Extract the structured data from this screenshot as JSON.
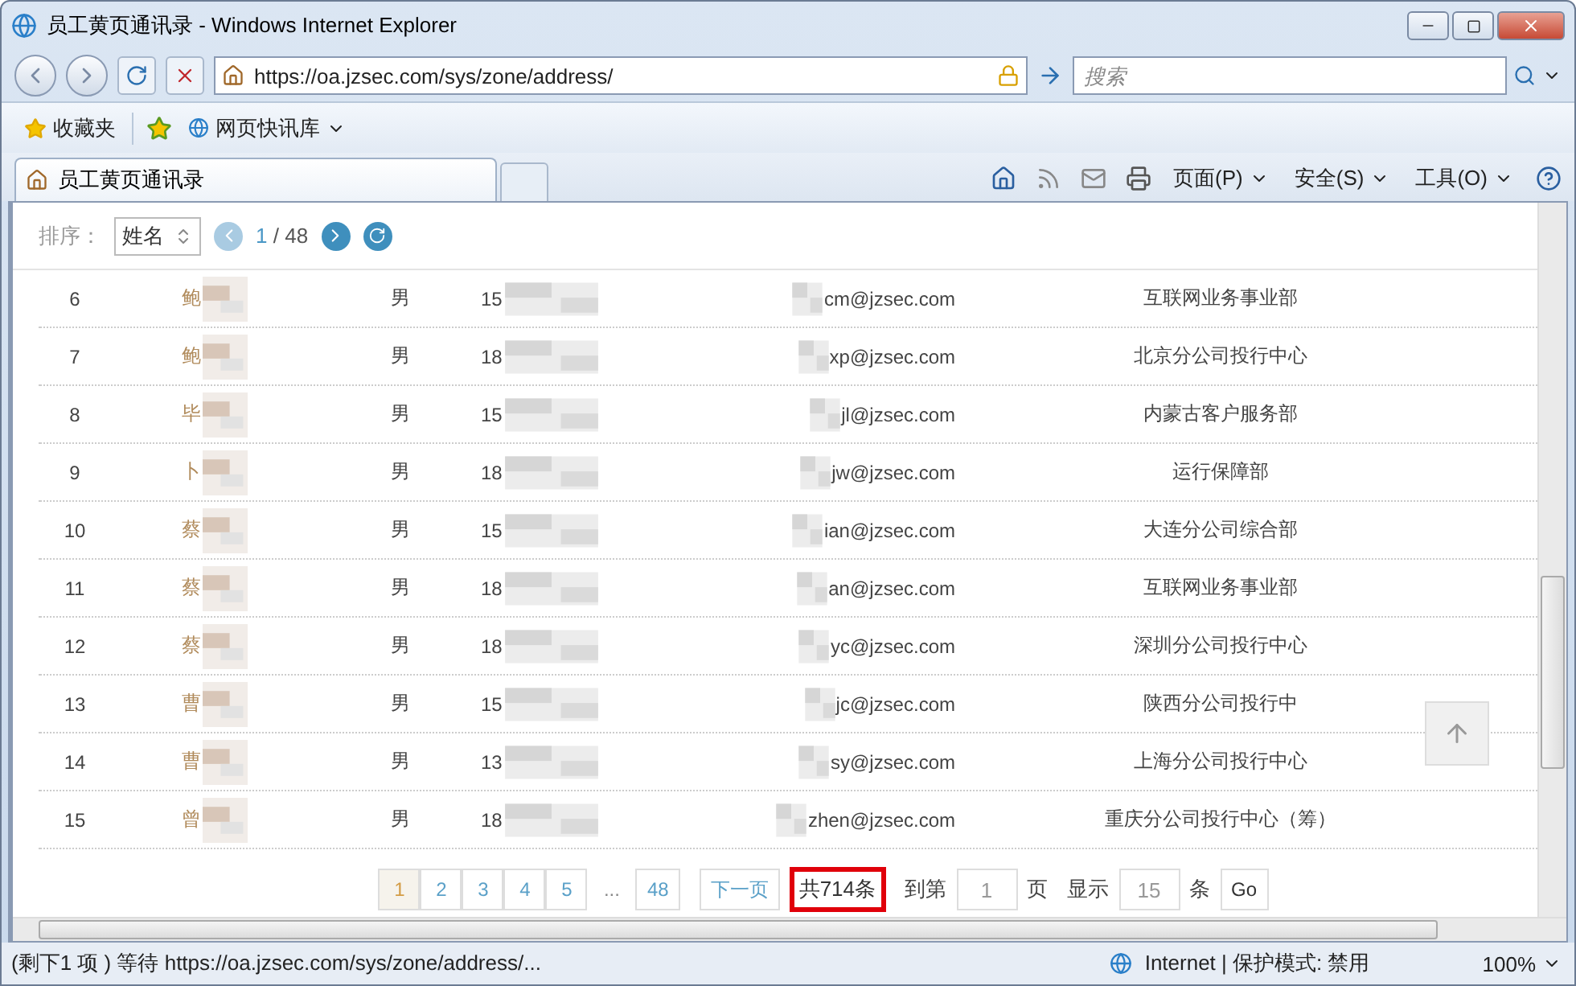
{
  "window": {
    "title": "员工黄页通讯录 - Windows Internet Explorer"
  },
  "address_bar": {
    "url": "https://oa.jzsec.com/sys/zone/address/"
  },
  "search": {
    "placeholder": "搜索"
  },
  "favorites_bar": {
    "favorites": "收藏夹",
    "web_slice": "网页快讯库"
  },
  "tab": {
    "title": "员工黄页通讯录"
  },
  "command_bar": [
    "页面(P)",
    "安全(S)",
    "工具(O)"
  ],
  "sort_bar": {
    "label": "排序：",
    "field": "姓名",
    "page": "1",
    "total": "/ 48"
  },
  "rows": [
    {
      "index": "6",
      "name": "鲍",
      "gender": "男",
      "phone": "15",
      "email": "cm@jzsec.com",
      "department": "互联网业务事业部"
    },
    {
      "index": "7",
      "name": "鲍",
      "gender": "男",
      "phone": "18",
      "email": "xp@jzsec.com",
      "department": "北京分公司投行中心"
    },
    {
      "index": "8",
      "name": "毕",
      "gender": "男",
      "phone": "15",
      "email": "jl@jzsec.com",
      "department": "内蒙古客户服务部"
    },
    {
      "index": "9",
      "name": "卜",
      "gender": "男",
      "phone": "18",
      "email": "jw@jzsec.com",
      "department": "运行保障部"
    },
    {
      "index": "10",
      "name": "蔡",
      "gender": "男",
      "phone": "15",
      "email": "ian@jzsec.com",
      "department": "大连分公司综合部"
    },
    {
      "index": "11",
      "name": "蔡",
      "gender": "男",
      "phone": "18",
      "email": "an@jzsec.com",
      "department": "互联网业务事业部"
    },
    {
      "index": "12",
      "name": "蔡",
      "gender": "男",
      "phone": "18",
      "email": "yc@jzsec.com",
      "department": "深圳分公司投行中心"
    },
    {
      "index": "13",
      "name": "曹",
      "gender": "男",
      "phone": "15",
      "email": "jc@jzsec.com",
      "department": "陕西分公司投行中"
    },
    {
      "index": "14",
      "name": "曹",
      "gender": "男",
      "phone": "13",
      "email": "sy@jzsec.com",
      "department": "上海分公司投行中心"
    },
    {
      "index": "15",
      "name": "曾",
      "gender": "男",
      "phone": "18",
      "email": "zhen@jzsec.com",
      "department": "重庆分公司投行中心（筹）"
    }
  ],
  "pagination": {
    "pages": [
      {
        "label": "1",
        "selected": true
      },
      {
        "label": "2",
        "selected": false
      },
      {
        "label": "3",
        "selected": false
      },
      {
        "label": "4",
        "selected": false
      },
      {
        "label": "5",
        "selected": false
      }
    ],
    "ellipsis": "...",
    "last": "48",
    "next": "下一页",
    "total": "共714条",
    "goto_label": "到第",
    "goto_value": "1",
    "page_unit": "页",
    "show_label": "显示",
    "show_value": "15",
    "show_unit": "条",
    "go": "Go"
  },
  "status_bar": {
    "text": "(剩下1 项 ) 等待 https://oa.jzsec.com/sys/zone/address/...",
    "zone": "Internet | 保护模式: 禁用",
    "zoom": "100%"
  }
}
